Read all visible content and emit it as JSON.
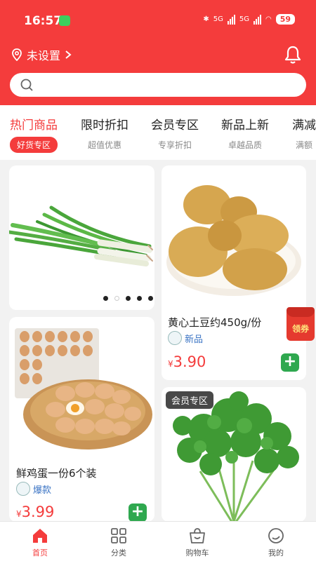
{
  "status": {
    "time": "16:57",
    "battery": "59",
    "network": "5G"
  },
  "location": {
    "label": "未设置"
  },
  "search": {
    "placeholder": ""
  },
  "tabs": [
    {
      "title": "热门商品",
      "sub": "好货专区"
    },
    {
      "title": "限时折扣",
      "sub": "超值优惠"
    },
    {
      "title": "会员专区",
      "sub": "专享折扣"
    },
    {
      "title": "新品上新",
      "sub": "卓越品质"
    },
    {
      "title": "满减",
      "sub": "满额"
    }
  ],
  "products": [
    {
      "name": "黄心土豆约450g/份",
      "tag": "新品",
      "currency": "¥",
      "price": "3.90"
    },
    {
      "name": "鲜鸡蛋一份6个装",
      "tag": "爆款",
      "currency": "¥",
      "price": "3.99"
    }
  ],
  "badges": {
    "member": "会员专区"
  },
  "coupon": {
    "label": "领券"
  },
  "nav": [
    {
      "label": "首页"
    },
    {
      "label": "分类"
    },
    {
      "label": "购物车"
    },
    {
      "label": "我的"
    }
  ],
  "colors": {
    "brand": "#f43c3c",
    "add": "#2fa84f",
    "tag": "#3b74c4"
  }
}
